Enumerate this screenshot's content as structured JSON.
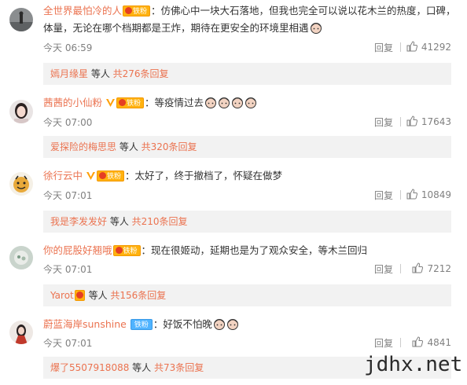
{
  "comments": [
    {
      "username": "全世界最怕冷的人",
      "badge": "铁粉",
      "text": "：仿佛心中一块大石落地，但我也完全可以说以花木兰的热度，口碑，体量，无论在哪个档期都是王炸，期待在更安全的环境里相遇",
      "time": "今天 06:59",
      "reply_label": "回复",
      "likes": "41292",
      "reply_user": "嫣月缘星",
      "reply_mid": " 等人 ",
      "reply_count": "共276条回复"
    },
    {
      "username": "茜茜的小仙粉",
      "badge": "铁粉",
      "text": "：等疫情过去",
      "time": "今天 07:00",
      "reply_label": "回复",
      "likes": "17643",
      "reply_user": "爱探险的梅思思",
      "reply_mid": " 等人 ",
      "reply_count": "共320条回复"
    },
    {
      "username": "徐行云中",
      "badge": "铁粉",
      "text": "：太好了，终于撤档了，怀疑在做梦",
      "time": "今天 07:01",
      "reply_label": "回复",
      "likes": "10849",
      "reply_user": "我是李发发好",
      "reply_mid": " 等人 ",
      "reply_count": "共210条回复"
    },
    {
      "username": "你的屁股好翘哦",
      "badge": "铁粉",
      "text": "：现在很姬动，延期也是为了观众安全，等木兰回归",
      "time": "今天 07:01",
      "reply_label": "回复",
      "likes": "7212",
      "reply_user": "Yarot",
      "reply_mid": " 等人 ",
      "reply_count": "共156条回复"
    },
    {
      "username": "蔚蓝海岸sunshine",
      "badge": "铁粉",
      "text": "：好饭不怕晚",
      "time": "今天 07:01",
      "reply_label": "回复",
      "likes": "4841",
      "reply_user": "爆了5507918088",
      "reply_mid": " 等人 ",
      "reply_count": "共73条回复"
    }
  ],
  "watermark": "jdhx.net",
  "colors": {
    "username": "#eb7350",
    "meta": "#808080",
    "reply_bg": "#f2f2f2",
    "badge_gold": "#ffb20f",
    "badge_blue": "#4fb3ff"
  },
  "icons": {
    "like": "thumbs-up-icon",
    "verified": "v-verified-icon",
    "emoji": "face-emoji-icon"
  }
}
